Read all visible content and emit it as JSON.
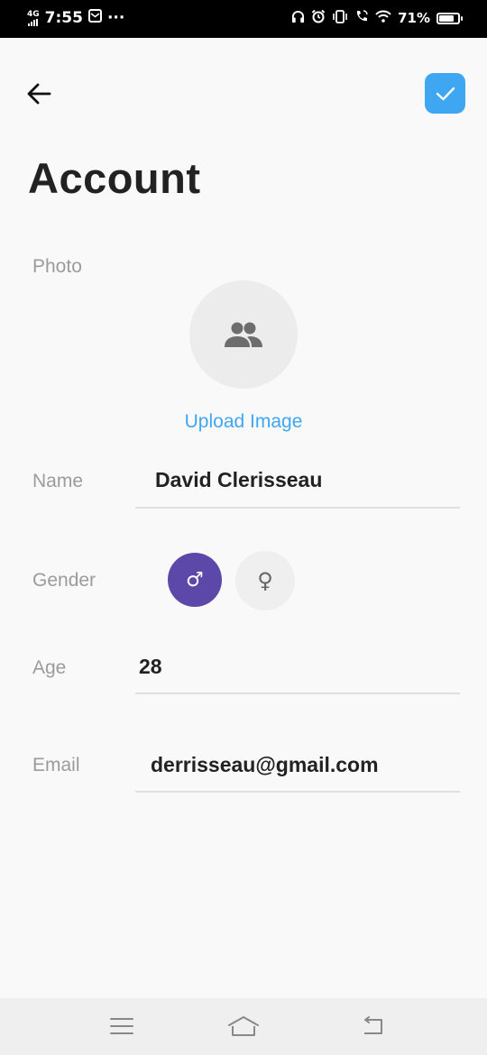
{
  "status_bar": {
    "network": "4G",
    "time": "7:55",
    "more": "···",
    "battery_percent": "71%",
    "battery_level": 0.71
  },
  "header": {
    "title": "Account"
  },
  "form": {
    "photo_label": "Photo",
    "upload_label": "Upload Image",
    "name_label": "Name",
    "name_value": "David Clerisseau",
    "gender_label": "Gender",
    "gender_male_symbol": "♂",
    "gender_female_symbol": "♀",
    "gender_selected": "male",
    "age_label": "Age",
    "age_value": "28",
    "email_label": "Email",
    "email_value": "derrisseau@gmail.com"
  },
  "colors": {
    "accent": "#3fa7f2",
    "selected_gender": "#5b48a8",
    "title_text": "#222222",
    "label_text": "#9b9b9b"
  },
  "icons": {
    "back": "arrow-left-icon",
    "confirm": "check-icon",
    "avatar": "people-icon",
    "nav_menu": "menu-icon",
    "nav_home": "home-icon",
    "nav_back": "return-icon"
  }
}
